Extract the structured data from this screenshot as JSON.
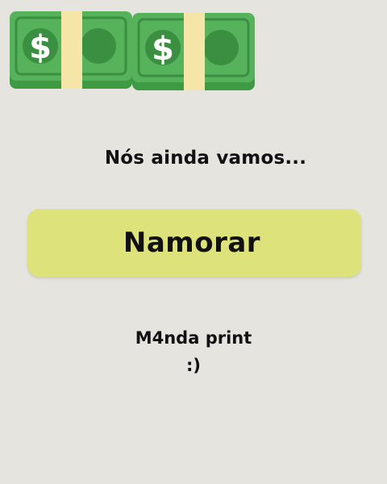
{
  "decorations": {
    "icons": [
      "money-bill-icon",
      "money-bill-icon"
    ],
    "bill_symbol": "$",
    "bill_green": "#4caf50",
    "bill_dark_green": "#2e7d32",
    "bill_band": "#fde9a0"
  },
  "quiz": {
    "prompt": "Nós ainda vamos...",
    "answer_label": "Namorar",
    "answer_color": "#dde37a"
  },
  "footer": {
    "line1": "M4nda print",
    "line2": ":)"
  }
}
